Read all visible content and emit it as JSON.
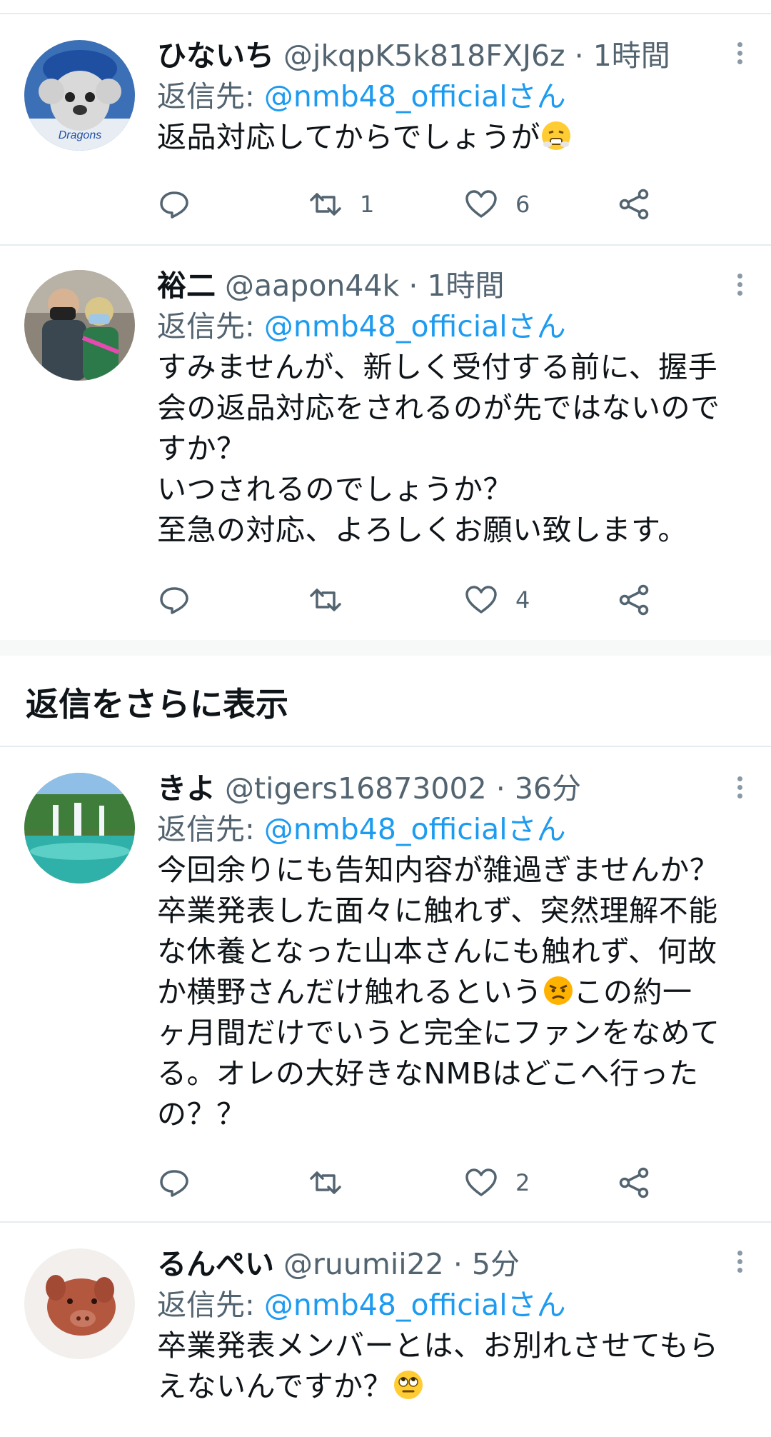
{
  "tweets": [
    {
      "name": "ひないち",
      "handle": "@jkqpK5k818FXJ6z",
      "separator": "·",
      "time": "1時間",
      "reply_prefix": "返信先: ",
      "reply_mention": "@nmb48_officialさん",
      "text": "返品対応してからでしょうが",
      "emoji": "steam-from-nose-emoji",
      "replies": "",
      "retweets": "1",
      "likes": "6"
    },
    {
      "name": "裕二",
      "handle": "@aapon44k",
      "separator": "·",
      "time": "1時間",
      "reply_prefix": "返信先: ",
      "reply_mention": "@nmb48_officialさん",
      "text": "すみませんが、新しく受付する前に、握手\n会の返品対応をされるのが先ではないので\nすか？\nいつされるのでしょうか？\n至急の対応、よろしくお願い致します。",
      "replies": "",
      "retweets": "",
      "likes": "4"
    },
    {
      "name": "きよ",
      "handle": "@tigers16873002",
      "separator": "·",
      "time": "36分",
      "reply_prefix": "返信先: ",
      "reply_mention": "@nmb48_officialさん",
      "text_part1": "今回余りにも告知内容が雑過ぎませんか？\n卒業発表した面々に触れず、突然理解不能\nな休養となった山本さんにも触れず、何故\nか横野さんだけ触れるという",
      "emoji": "angry-face-emoji",
      "text_part2": "この約一\nヶ月間だけでいうと完全にファンをなめて\nる。オレの大好きなNMBはどこへ行った\nの？？",
      "replies": "",
      "retweets": "",
      "likes": "2"
    },
    {
      "name": "るんぺい",
      "handle": "@ruumii22",
      "separator": "·",
      "time": "5分",
      "reply_prefix": "返信先: ",
      "reply_mention": "@nmb48_officialさん",
      "text": "卒業発表メンバーとは、お別れさせてもら\nえないんですか？",
      "emoji": "face-with-rolling-eyes-emoji"
    }
  ],
  "show_more_replies": "返信をさらに表示",
  "colors": {
    "accent": "#1d9bf0",
    "secondary_text": "#536471",
    "divider": "#e6ecf0"
  }
}
